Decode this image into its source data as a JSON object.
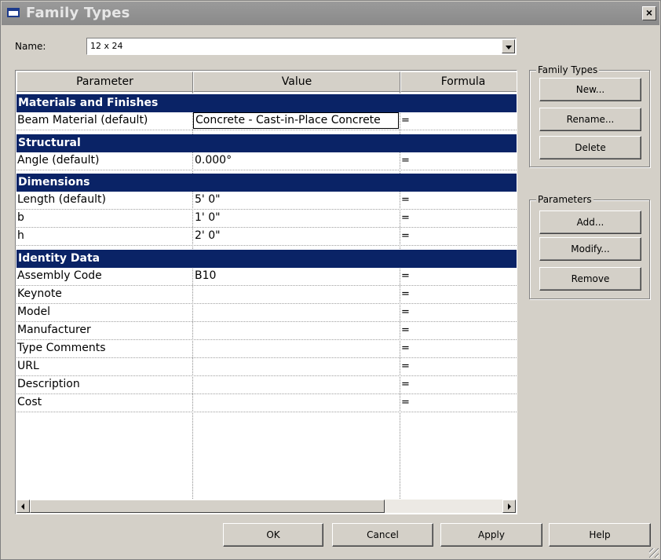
{
  "window": {
    "title": "Family Types",
    "close_glyph": "×"
  },
  "name_field": {
    "label": "Name:",
    "value": "12 x 24"
  },
  "columns": {
    "parameter": "Parameter",
    "value": "Value",
    "formula": "Formula"
  },
  "sections": [
    {
      "title": "Materials and Finishes",
      "rows": [
        {
          "parameter": "Beam Material (default)",
          "value": "Concrete - Cast-in-Place Concrete",
          "formula": "="
        }
      ]
    },
    {
      "title": "Structural",
      "rows": [
        {
          "parameter": "Angle (default)",
          "value": "0.000°",
          "formula": "="
        }
      ]
    },
    {
      "title": "Dimensions",
      "rows": [
        {
          "parameter": "Length (default)",
          "value": "5'  0\"",
          "formula": "="
        },
        {
          "parameter": "b",
          "value": "1'  0\"",
          "formula": "="
        },
        {
          "parameter": "h",
          "value": "2'  0\"",
          "formula": "="
        }
      ]
    },
    {
      "title": "Identity Data",
      "rows": [
        {
          "parameter": "Assembly Code",
          "value": "B10",
          "formula": "="
        },
        {
          "parameter": "Keynote",
          "value": "",
          "formula": "="
        },
        {
          "parameter": "Model",
          "value": "",
          "formula": "="
        },
        {
          "parameter": "Manufacturer",
          "value": "",
          "formula": "="
        },
        {
          "parameter": "Type Comments",
          "value": "",
          "formula": "="
        },
        {
          "parameter": "URL",
          "value": "",
          "formula": "="
        },
        {
          "parameter": "Description",
          "value": "",
          "formula": "="
        },
        {
          "parameter": "Cost",
          "value": "",
          "formula": "="
        }
      ]
    }
  ],
  "family_types_group": {
    "label": "Family Types",
    "new": "New...",
    "rename": "Rename...",
    "delete": "Delete"
  },
  "parameters_group": {
    "label": "Parameters",
    "add": "Add...",
    "modify": "Modify...",
    "remove": "Remove"
  },
  "footer": {
    "ok": "OK",
    "cancel": "Cancel",
    "apply": "Apply",
    "help": "Help"
  },
  "colors": {
    "section_header": "#0a2366",
    "dialog_bg": "#d4d0c8"
  }
}
